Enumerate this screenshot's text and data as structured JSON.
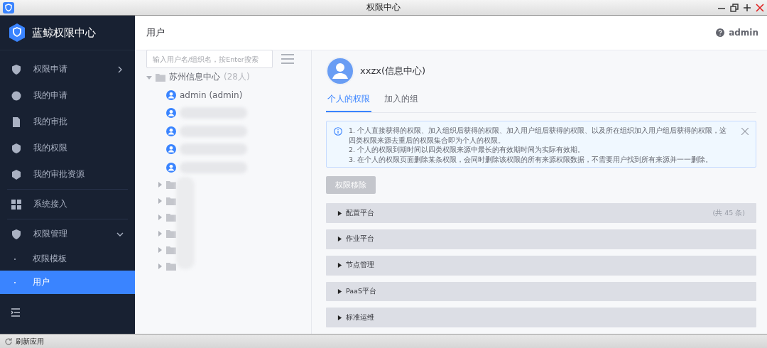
{
  "window": {
    "title": "权限中心"
  },
  "app": {
    "name": "蓝鲸权限中心"
  },
  "sidebar": {
    "items": [
      {
        "kind": "item",
        "label": "权限申请",
        "expanded": false,
        "selected": false
      },
      {
        "kind": "item",
        "label": "我的申请",
        "selected": false
      },
      {
        "kind": "item",
        "label": "我的审批",
        "selected": false
      },
      {
        "kind": "item",
        "label": "我的权限",
        "selected": false
      },
      {
        "kind": "item",
        "label": "我的审批资源",
        "selected": false
      },
      {
        "kind": "item",
        "label": "系统接入",
        "selected": false
      },
      {
        "kind": "item",
        "label": "权限管理",
        "expanded": true,
        "selected": false,
        "children": [
          {
            "label": "权限模板",
            "selected": false
          },
          {
            "label": "用户",
            "selected": true
          }
        ]
      }
    ]
  },
  "header": {
    "title": "用户",
    "user": "admin"
  },
  "tree": {
    "search": {
      "placeholder": "输入用户名/组织名，按Enter搜索"
    },
    "root": {
      "label": "苏州信息中心",
      "count": "(28人)",
      "expanded": true,
      "users": [
        {
          "name": "admin (admin)",
          "redacted": false
        },
        {
          "redacted": true
        },
        {
          "redacted": true
        },
        {
          "redacted": true
        },
        {
          "redacted": true
        }
      ],
      "folders": [
        {
          "expanded": false
        },
        {
          "expanded": false
        },
        {
          "expanded": false
        },
        {
          "expanded": false
        },
        {
          "expanded": false
        },
        {
          "expanded": false
        }
      ]
    }
  },
  "profile": {
    "name": "xxzx(信息中心)"
  },
  "tabs": [
    {
      "label": "个人的权限",
      "selected": true
    },
    {
      "label": "加入的组",
      "selected": false
    }
  ],
  "notice": [
    "1. 个人直接获得的权限、加入组织后获得的权限、加入用户组后获得的权限、以及所在组织加入用户组后获得的权限，这四类权限来源去重后的权限集合即为个人的权限。",
    "2. 个人的权限到期时间以四类权限来源中最长的有效期时间为实际有效期。",
    "3. 在个人的权限页面删除某条权限，会同时删除该权限的所有来源权限数据，不需要用户找到所有来源并一一删除。"
  ],
  "remove_button": {
    "label": "权限移除",
    "disabled": true
  },
  "panels": [
    {
      "title": "配置平台",
      "count": "(共 45 条)",
      "expanded": false
    },
    {
      "title": "作业平台",
      "expanded": false
    },
    {
      "title": "节点管理",
      "expanded": false
    },
    {
      "title": "PaaS平台",
      "expanded": false
    },
    {
      "title": "标准运维",
      "expanded": false
    }
  ],
  "status_bar": {
    "text": "刷新应用"
  }
}
